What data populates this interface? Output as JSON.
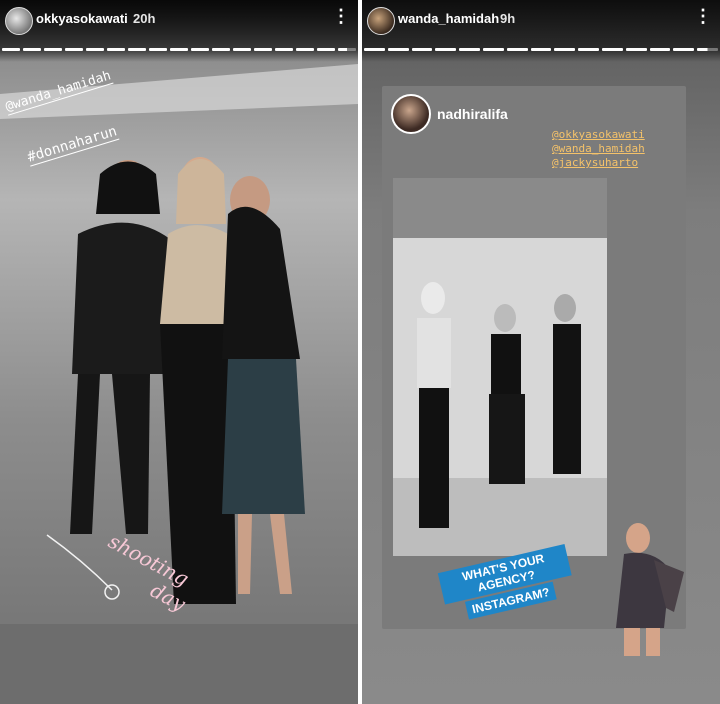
{
  "stories": [
    {
      "username": "okkyasokawati",
      "time": "20h",
      "more_icon": "⋮",
      "progress": {
        "segments": 17,
        "active_index": 16,
        "active_fraction": 0.5
      },
      "mentions": [
        "@wanda_hamidah",
        "#donnaharun"
      ],
      "sticker_words": [
        "shooting",
        "day"
      ]
    },
    {
      "username": "wanda_hamidah",
      "time": "9h",
      "more_icon": "⋮",
      "progress": {
        "segments": 15,
        "active_index": 14,
        "active_fraction": 0.5
      },
      "shared_post": {
        "username": "nadhiralifa",
        "mentions": [
          "@okkyasokawati",
          "@wanda_hamidah",
          "@jackysuharto"
        ]
      },
      "sticker": {
        "line1": "WHAT'S YOUR AGENCY?",
        "line2": "INSTAGRAM?"
      }
    }
  ]
}
